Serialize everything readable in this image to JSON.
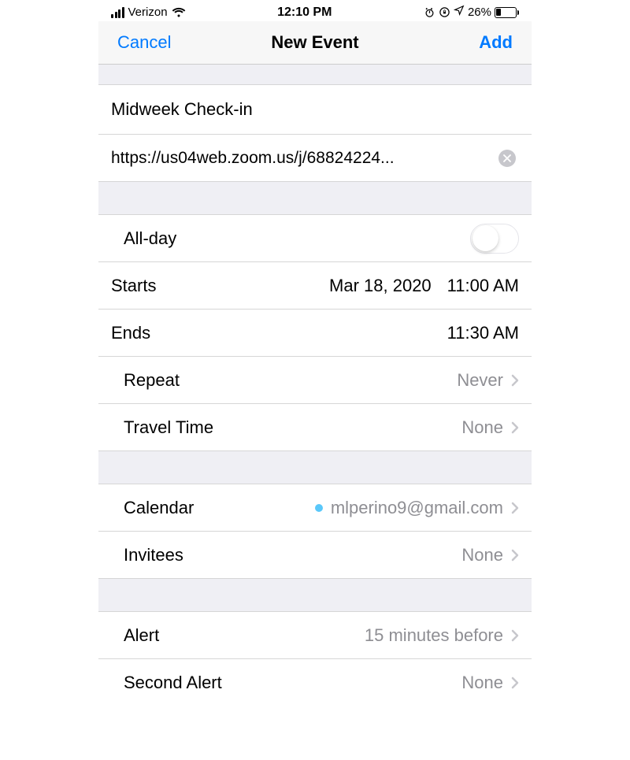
{
  "status": {
    "carrier": "Verizon",
    "time": "12:10 PM",
    "battery_pct": "26%"
  },
  "nav": {
    "cancel": "Cancel",
    "title": "New Event",
    "add": "Add"
  },
  "event": {
    "title": "Midweek Check-in",
    "location": "https://us04web.zoom.us/j/68824224..."
  },
  "allday": {
    "label": "All-day"
  },
  "starts": {
    "label": "Starts",
    "date": "Mar 18, 2020",
    "time": "11:00 AM"
  },
  "ends": {
    "label": "Ends",
    "time": "11:30 AM"
  },
  "repeat": {
    "label": "Repeat",
    "value": "Never"
  },
  "travel": {
    "label": "Travel Time",
    "value": "None"
  },
  "calendar": {
    "label": "Calendar",
    "value": "mlperino9@gmail.com",
    "dot_color": "#5ac8fa"
  },
  "invitees": {
    "label": "Invitees",
    "value": "None"
  },
  "alert": {
    "label": "Alert",
    "value": "15 minutes before"
  },
  "second_alert": {
    "label": "Second Alert",
    "value": "None"
  }
}
